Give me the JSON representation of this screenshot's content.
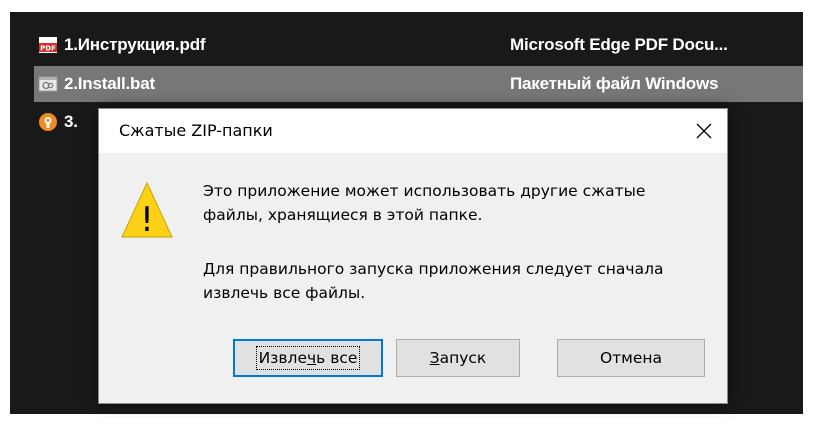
{
  "explorer": {
    "files": [
      {
        "name": "1.Инструкция.pdf",
        "type": "Microsoft Edge PDF Docu...",
        "icon": "pdf-icon",
        "icon_label": "PDF"
      },
      {
        "name": "2.Install.bat",
        "type": "Пакетный файл Windows",
        "icon": "batch-file-icon",
        "selected": true
      },
      {
        "name": "3.",
        "type": "",
        "icon": "openvpn-icon"
      }
    ]
  },
  "dialog": {
    "title": "Сжатые ZIP-папки",
    "close_glyph": "✕",
    "message1": "Это приложение может использовать другие сжатые файлы, хранящиеся в этой папке.",
    "message2": "Для правильного запуска приложения следует сначала извлечь все файлы.",
    "warning_icon_glyph": "!",
    "buttons": {
      "extract": {
        "pre": "Извле",
        "mnemonic": "ч",
        "post": "ь все"
      },
      "run": {
        "pre": "",
        "mnemonic": "З",
        "post": "апуск"
      },
      "cancel": {
        "label": "Отмена"
      }
    }
  },
  "colors": {
    "explorer_bg": "#191919",
    "selected_row": "#777777",
    "dialog_bg": "#f0f0f0",
    "default_button_border": "#0078d7",
    "warning_yellow": "#fcd116"
  }
}
